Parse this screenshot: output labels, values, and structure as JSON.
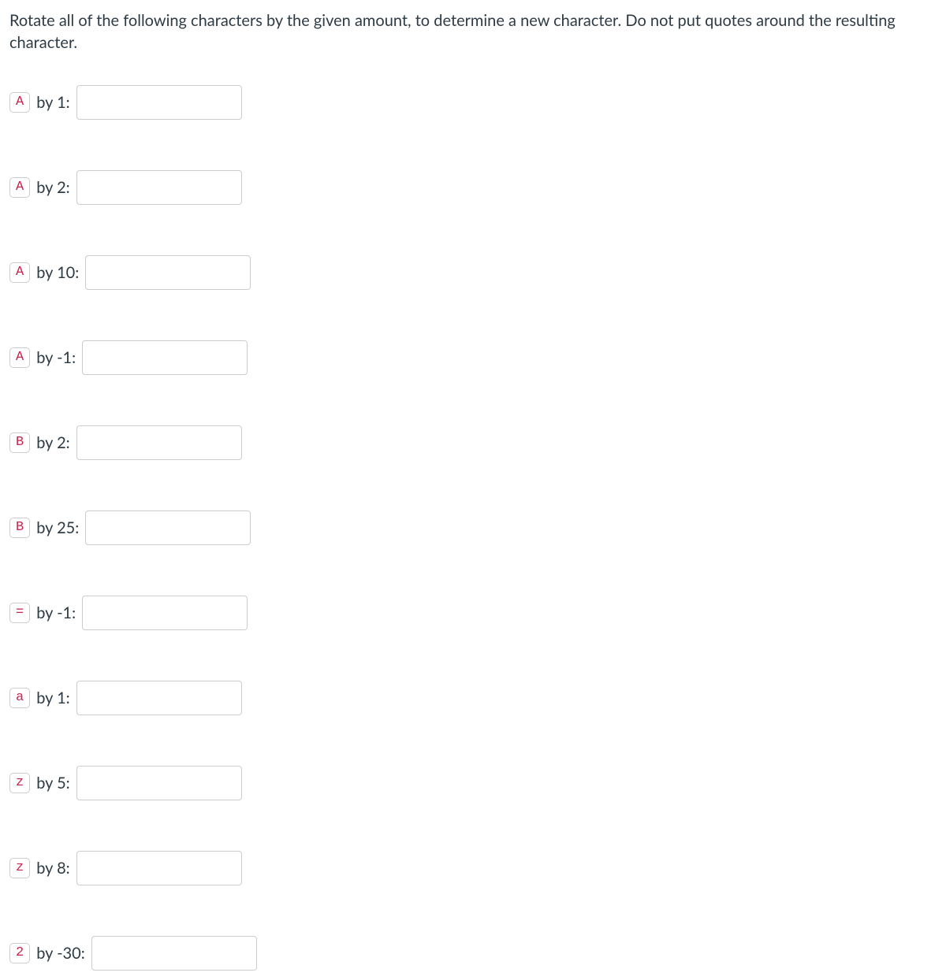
{
  "instructions": "Rotate all of the following characters by the given amount, to determine a new character. Do not put quotes around the resulting character.",
  "by_word": "by",
  "questions": [
    {
      "char": "A",
      "amount": "1"
    },
    {
      "char": "A",
      "amount": "2"
    },
    {
      "char": "A",
      "amount": "10"
    },
    {
      "char": "A",
      "amount": "-1"
    },
    {
      "char": "B",
      "amount": "2"
    },
    {
      "char": "B",
      "amount": "25"
    },
    {
      "char": "=",
      "amount": "-1"
    },
    {
      "char": "a",
      "amount": "1"
    },
    {
      "char": "z",
      "amount": "5"
    },
    {
      "char": "z",
      "amount": "8"
    },
    {
      "char": "2",
      "amount": "-30"
    }
  ]
}
